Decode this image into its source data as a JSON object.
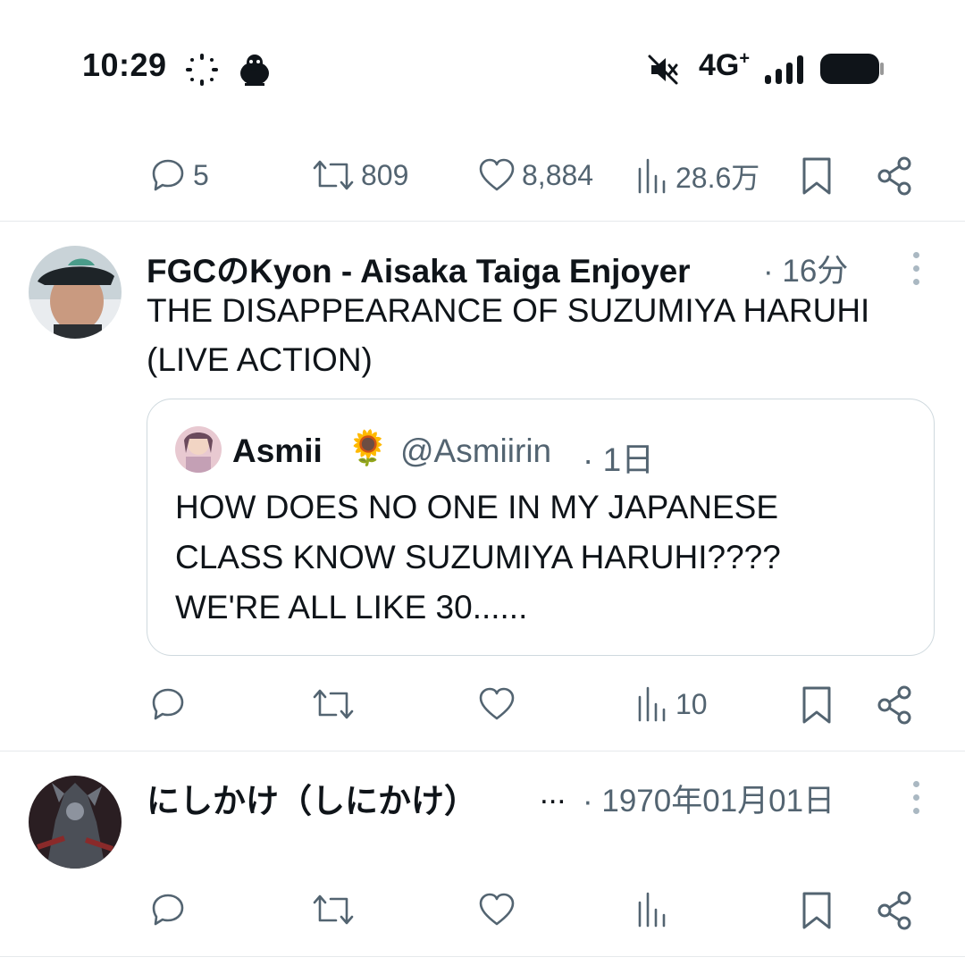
{
  "status_bar": {
    "time": "10:29",
    "network": "4G",
    "network_plus": "+",
    "battery_level": 0.9
  },
  "top_actions": {
    "replies": "5",
    "retweets": "809",
    "likes": "8,884",
    "views": "28.6万"
  },
  "tweets": [
    {
      "author": "FGCのKyon - Aisaka Taiga Enjoyer",
      "meta": "· 16分",
      "text_line1": "THE DISAPPEARANCE OF SUZUMIYA HARUHI",
      "text_line2": "(LIVE ACTION)",
      "quote": {
        "author": "Asmii",
        "emoji": "🌻",
        "handle": "@Asmiirin",
        "time": "· 1日",
        "line1": "HOW DOES NO ONE IN MY JAPANESE",
        "line2": "CLASS KNOW SUZUMIYA HARUHI????",
        "line3": "WE'RE ALL LIKE 30......"
      },
      "actions": {
        "views": "10"
      }
    },
    {
      "author": "にしかけ（しにかけ）",
      "ellipsis": "...",
      "meta": "· 1970年01月01日"
    }
  ],
  "icons": {
    "reply": "reply-icon",
    "retweet": "retweet-icon",
    "like": "heart-icon",
    "views": "views-icon",
    "bookmark": "bookmark-icon",
    "share": "share-icon",
    "more": "more-icon"
  },
  "colors": {
    "text": "#0f1419",
    "muted": "#536471",
    "border": "#cfd9de"
  }
}
